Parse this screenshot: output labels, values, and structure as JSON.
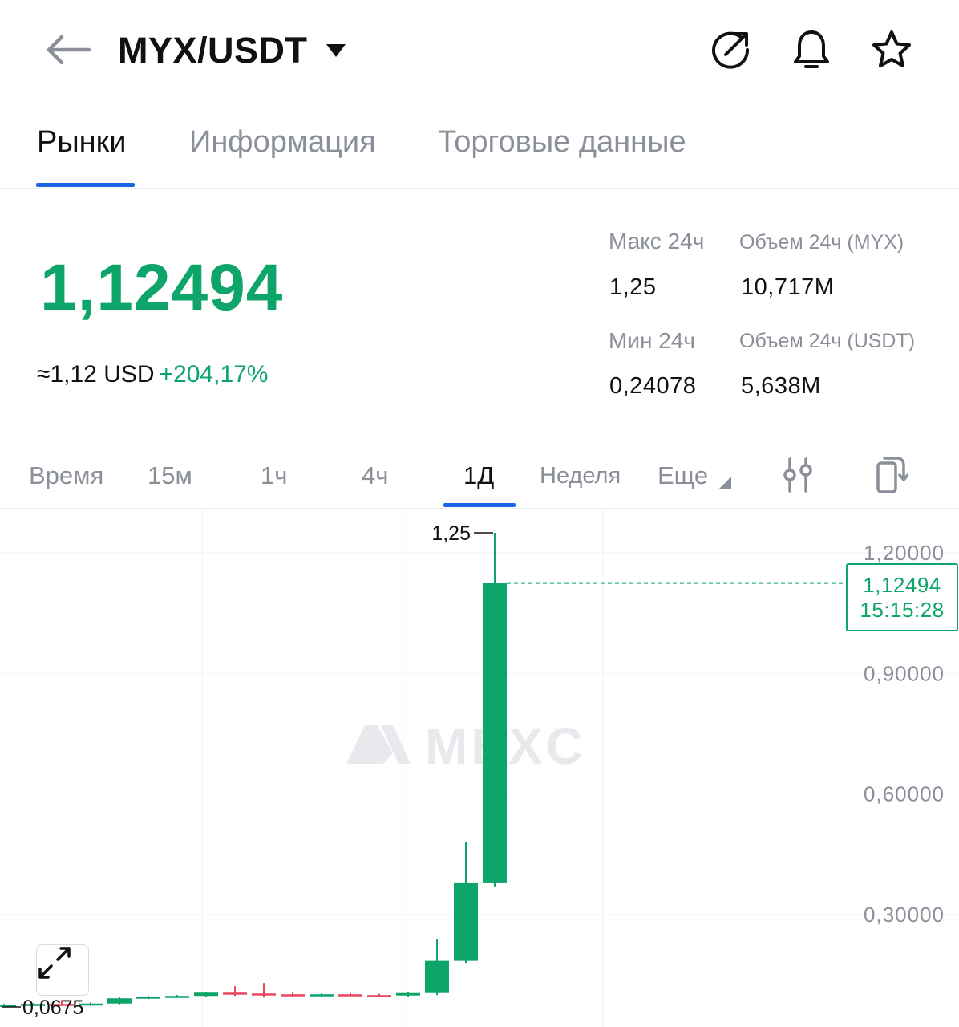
{
  "header": {
    "pair": "MYX/USDT",
    "icons": [
      "back-arrow-icon",
      "caret-down-icon",
      "share-icon",
      "bell-icon",
      "star-icon"
    ]
  },
  "tabs": [
    {
      "label": "Рынки",
      "active": true
    },
    {
      "label": "Информация",
      "active": false
    },
    {
      "label": "Торговые данные",
      "active": false
    }
  ],
  "ticker": {
    "price": "1,12494",
    "usd_approx": "≈1,12 USD",
    "change": "+204,17%",
    "high_label": "Макс 24ч",
    "high_value": "1,25",
    "low_label": "Мин 24ч",
    "low_value": "0,24078",
    "vol_base_label": "Объем 24ч (MYX)",
    "vol_base_value": "10,717M",
    "vol_quote_label": "Объем 24ч  (USDT)",
    "vol_quote_value": "5,638M",
    "accent_color": "#0ea56a"
  },
  "intervals": [
    {
      "label": "Время",
      "active": false
    },
    {
      "label": "15м",
      "active": false
    },
    {
      "label": "1ч",
      "active": false
    },
    {
      "label": "4ч",
      "active": false
    },
    {
      "label": "1Д",
      "active": true
    },
    {
      "label": "Неделя",
      "active": false
    },
    {
      "label": "Еще",
      "active": false
    }
  ],
  "chart_data": {
    "type": "candlestick",
    "y_ticks": [
      "1,20000",
      "0,90000",
      "0,60000",
      "0,30000"
    ],
    "y_tick_values": [
      1.2,
      0.9,
      0.6,
      0.3
    ],
    "last_price": "1,12494",
    "last_price_value": 1.12494,
    "countdown": "15:15:28",
    "max_marker": "1,25",
    "max_value": 1.25,
    "min_marker": "0,0675",
    "min_value": 0.0675,
    "watermark": "MEXC",
    "up_color": "#0ea56a",
    "down_color": "#e8475f",
    "candles": [
      {
        "o": 0.075,
        "h": 0.078,
        "l": 0.072,
        "c": 0.076
      },
      {
        "o": 0.076,
        "h": 0.08,
        "l": 0.073,
        "c": 0.078
      },
      {
        "o": 0.078,
        "h": 0.088,
        "l": 0.076,
        "c": 0.075
      },
      {
        "o": 0.075,
        "h": 0.082,
        "l": 0.073,
        "c": 0.079
      },
      {
        "o": 0.079,
        "h": 0.095,
        "l": 0.077,
        "c": 0.092
      },
      {
        "o": 0.092,
        "h": 0.098,
        "l": 0.09,
        "c": 0.096
      },
      {
        "o": 0.096,
        "h": 0.1,
        "l": 0.094,
        "c": 0.098
      },
      {
        "o": 0.098,
        "h": 0.108,
        "l": 0.096,
        "c": 0.106
      },
      {
        "o": 0.106,
        "h": 0.122,
        "l": 0.098,
        "c": 0.104
      },
      {
        "o": 0.104,
        "h": 0.13,
        "l": 0.094,
        "c": 0.102
      },
      {
        "o": 0.102,
        "h": 0.108,
        "l": 0.096,
        "c": 0.1
      },
      {
        "o": 0.1,
        "h": 0.104,
        "l": 0.097,
        "c": 0.102
      },
      {
        "o": 0.102,
        "h": 0.105,
        "l": 0.098,
        "c": 0.1
      },
      {
        "o": 0.1,
        "h": 0.103,
        "l": 0.097,
        "c": 0.099
      },
      {
        "o": 0.099,
        "h": 0.108,
        "l": 0.096,
        "c": 0.105
      },
      {
        "o": 0.105,
        "h": 0.24,
        "l": 0.1,
        "c": 0.185
      },
      {
        "o": 0.185,
        "h": 0.48,
        "l": 0.18,
        "c": 0.38
      },
      {
        "o": 0.38,
        "h": 1.25,
        "l": 0.37,
        "c": 1.12494
      }
    ]
  }
}
